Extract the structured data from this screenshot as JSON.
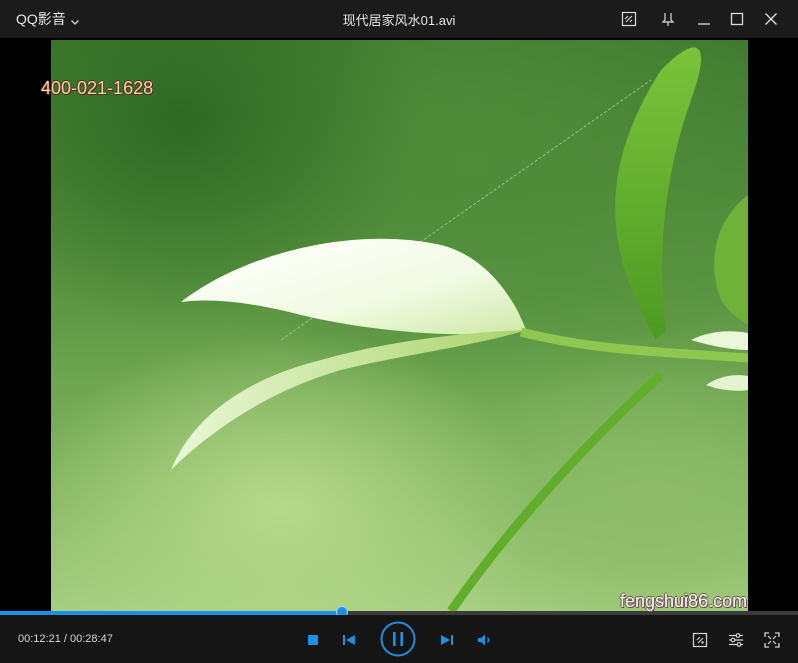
{
  "app": {
    "menu_label": "QQ影音",
    "file_title": "现代居家风水01.avi"
  },
  "video": {
    "watermark_phone": "400-021-1628",
    "watermark_site": "fengshui86.com"
  },
  "playback": {
    "current_time": "00:12:21",
    "separator": " / ",
    "total_time": "00:28:47",
    "progress": 0.429
  },
  "icons": {
    "menu_dropdown": "chevron-down-icon",
    "screenshot": "screenshot-icon",
    "pin": "pin-on-top-icon",
    "minimize": "minimize-icon",
    "maximize": "maximize-icon",
    "close": "close-icon",
    "stop": "stop-icon",
    "previous": "previous-icon",
    "play_pause": "pause-icon",
    "next": "next-icon",
    "volume": "volume-icon",
    "capture": "capture-icon",
    "settings": "settings-sliders-icon",
    "fullscreen": "fullscreen-icon"
  },
  "colors": {
    "accent": "#1e8fe1",
    "titlebar_bg": "#1b1b1b",
    "controlbar_bg": "#151515"
  }
}
